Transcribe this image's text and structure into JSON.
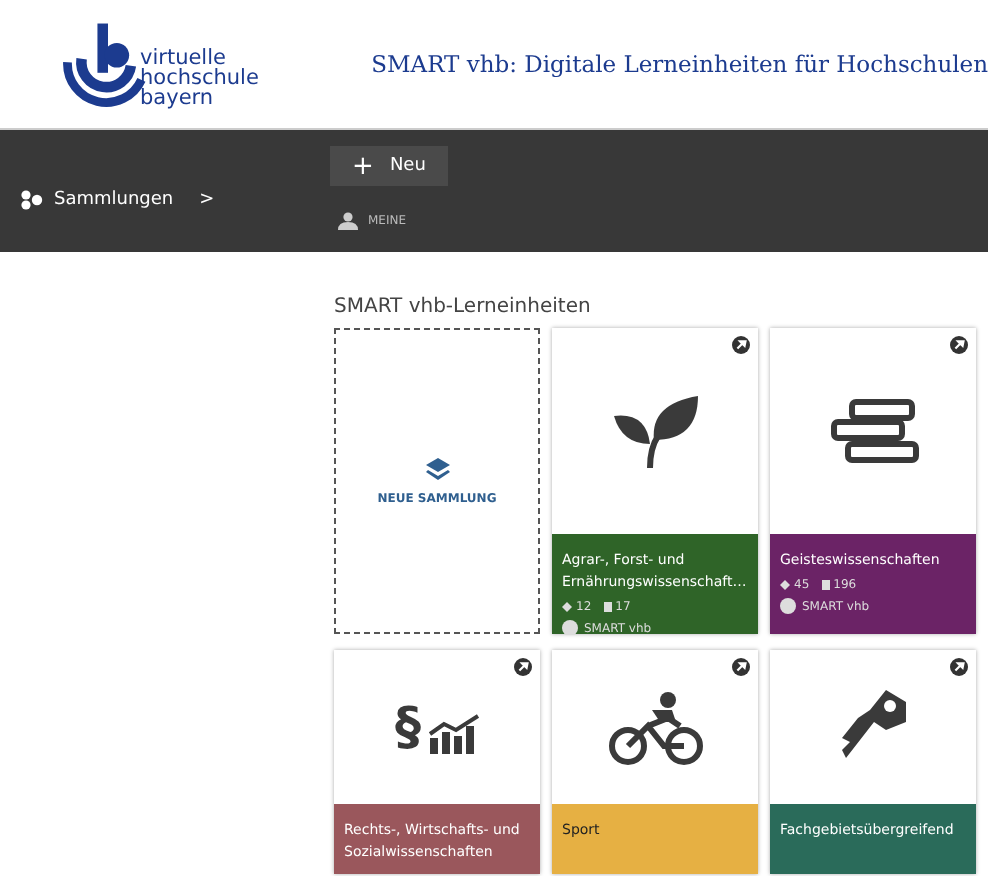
{
  "header": {
    "logo_lines": [
      "virtuelle",
      "hochschule",
      "bayern"
    ],
    "title": "SMART vhb: Digitale Lerneinheiten für Hochschulen"
  },
  "nav": {
    "collections": "Sammlungen",
    "chevron": ">",
    "new_button": "Neu",
    "plus": "+",
    "mine": "MEINE"
  },
  "section_title": "SMART vhb-Lerneinheiten",
  "new_collection": {
    "label": "NEUE SAMMLUNG"
  },
  "cards": [
    {
      "kind": "leaf",
      "title": "Agrar-, Forst- und Ernährungswissenschaft…",
      "color": "#2f6428",
      "dark_text": false,
      "collections": "12",
      "materials": "17",
      "owner": "SMART vhb"
    },
    {
      "kind": "books",
      "title": "Geisteswissenschaften",
      "color": "#6b2366",
      "dark_text": false,
      "collections": "45",
      "materials": "196",
      "owner": "SMART vhb"
    },
    {
      "kind": "law",
      "glyph": "§",
      "title": "Rechts-, Wirtschafts- und Sozialwissenschaften",
      "color": "#9a575c",
      "dark_text": false
    },
    {
      "kind": "bike",
      "title": "Sport",
      "color": "#e6b043",
      "dark_text": true
    },
    {
      "kind": "key",
      "title": "Fachgebietsübergreifend",
      "color": "#2a6b5a",
      "dark_text": false
    }
  ]
}
